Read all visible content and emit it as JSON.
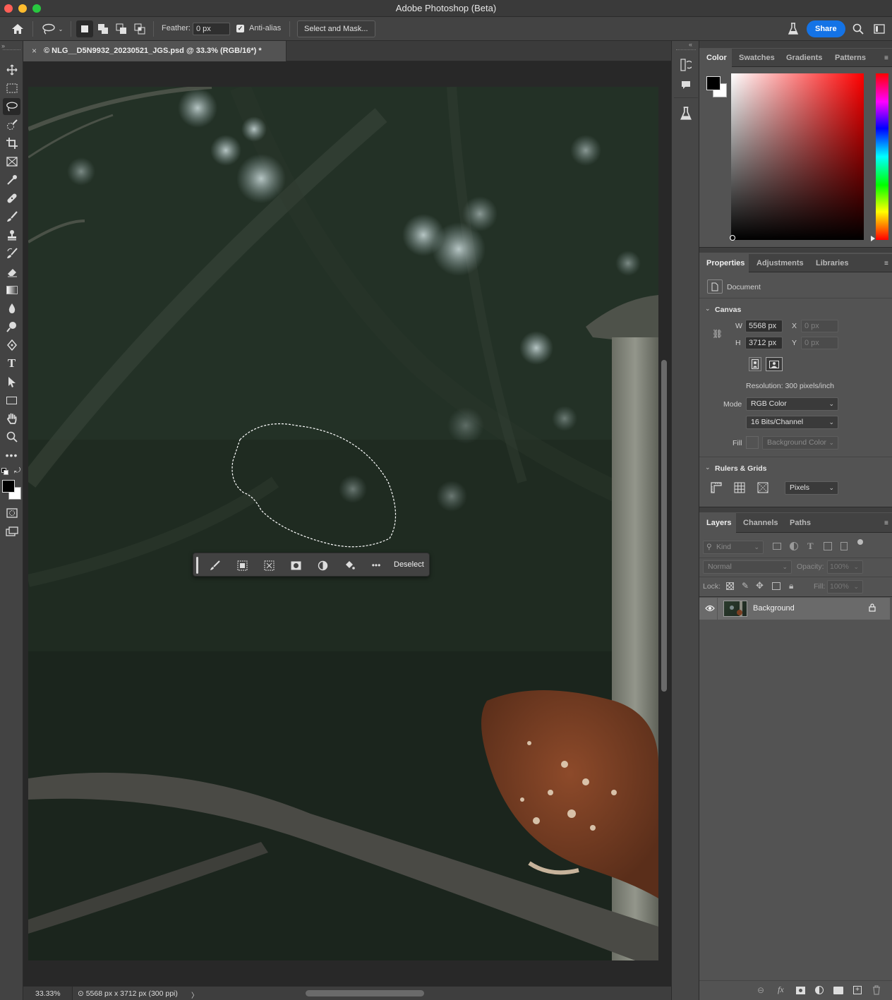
{
  "window": {
    "title": "Adobe Photoshop (Beta)"
  },
  "options_bar": {
    "feather_label": "Feather:",
    "feather_value": "0 px",
    "antialias_label": "Anti-alias",
    "antialias_checked": true,
    "select_mask_label": "Select and Mask...",
    "share_label": "Share"
  },
  "document": {
    "tab_title": "© NLG__D5N9932_20230521_JGS.psd @ 33.3% (RGB/16*) *",
    "tab_close": "×"
  },
  "status": {
    "zoom": "33.33%",
    "info": "⊙ 5568 px x 3712 px (300 ppi)",
    "more": "〉"
  },
  "contextual_taskbar": {
    "deselect_label": "Deselect"
  },
  "color_panel": {
    "tabs": [
      "Color",
      "Swatches",
      "Gradients",
      "Patterns"
    ],
    "active_tab": "Color",
    "foreground": "#000000",
    "background": "#ffffff",
    "hue_color": "#ff0000"
  },
  "properties_panel": {
    "tabs": [
      "Properties",
      "Adjustments",
      "Libraries"
    ],
    "active_tab": "Properties",
    "document_label": "Document",
    "canvas_header": "Canvas",
    "w_label": "W",
    "w_value": "5568 px",
    "h_label": "H",
    "h_value": "3712 px",
    "x_label": "X",
    "x_value": "0 px",
    "y_label": "Y",
    "y_value": "0 px",
    "resolution": "Resolution: 300 pixels/inch",
    "mode_label": "Mode",
    "mode_value": "RGB Color",
    "depth_value": "16 Bits/Channel",
    "fill_label": "Fill",
    "fill_value": "Background Color",
    "rulers_header": "Rulers & Grids",
    "units_value": "Pixels"
  },
  "layers_panel": {
    "tabs": [
      "Layers",
      "Channels",
      "Paths"
    ],
    "active_tab": "Layers",
    "filter_placeholder": "Kind",
    "blend_mode": "Normal",
    "opacity_label": "Opacity:",
    "opacity_value": "100%",
    "lock_label": "Lock:",
    "fill_label": "Fill:",
    "fill_value": "100%",
    "layers": [
      {
        "name": "Background",
        "visible": true,
        "locked": true
      }
    ]
  },
  "icons": {
    "home": "home-icon",
    "lasso": "lasso-icon",
    "search": "search-icon",
    "beaker": "beaker-icon"
  }
}
